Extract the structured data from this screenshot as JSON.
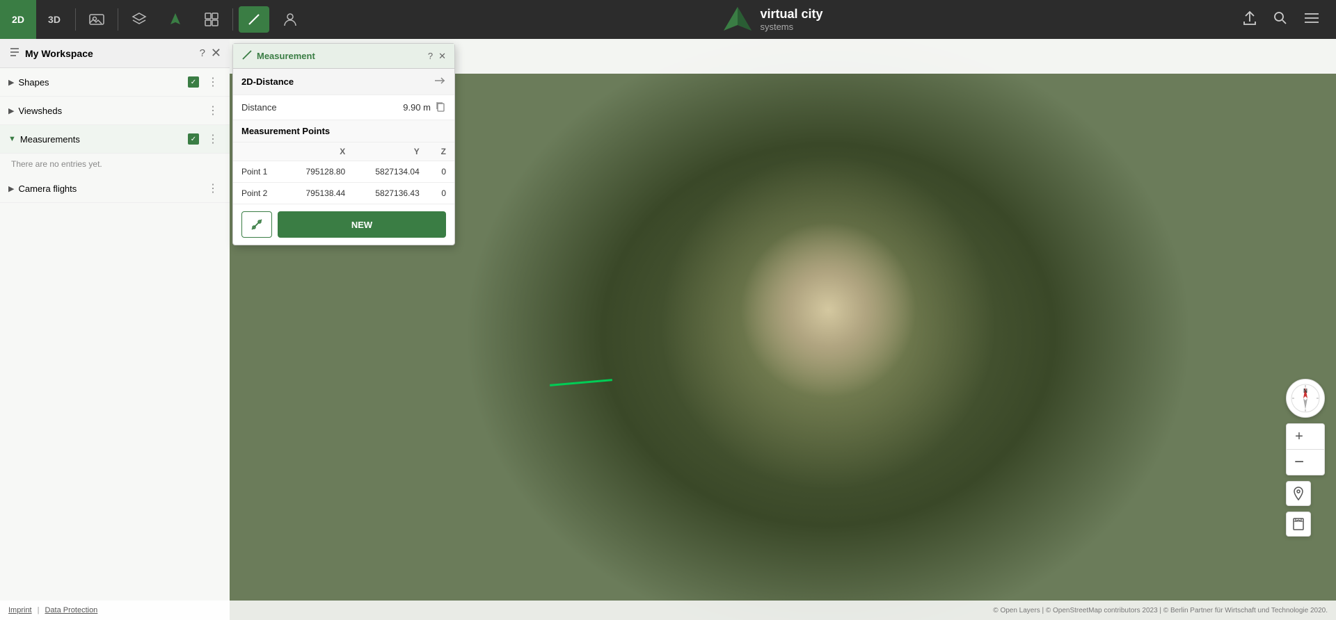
{
  "app": {
    "title": "virtual city systems",
    "title_line1": "virtual city",
    "title_line2": "systems"
  },
  "toolbar": {
    "btn_2d": "2D",
    "btn_3d": "3D",
    "share_icon": "⬆",
    "search_icon": "🔍",
    "menu_icon": "☰"
  },
  "sidebar": {
    "title": "My Workspace",
    "items": [
      {
        "label": "Shapes",
        "checked": true,
        "expanded": false
      },
      {
        "label": "Viewsheds",
        "checked": false,
        "expanded": false
      },
      {
        "label": "Measurements",
        "checked": true,
        "expanded": true
      },
      {
        "label": "Camera flights",
        "checked": false,
        "expanded": false
      }
    ],
    "empty_text": "There are no entries yet."
  },
  "measurement_panel": {
    "title": "Measurement",
    "type_label": "2D-Distance",
    "distance_label": "Distance",
    "distance_value": "9.90 m",
    "points_header": "Measurement Points",
    "col_x": "X",
    "col_y": "Y",
    "col_z": "Z",
    "points": [
      {
        "name": "Point 1",
        "x": "795128.80",
        "y": "5827134.04",
        "z": "0"
      },
      {
        "name": "Point 2",
        "x": "795138.44",
        "y": "5827136.43",
        "z": "0"
      }
    ],
    "new_btn": "NEW"
  },
  "bottom_bar": {
    "imprint": "Imprint",
    "data_protection": "Data Protection",
    "copyright": "© Open Layers  |  © OpenStreetMap contributors 2023  |  © Berlin Partner für Wirtschaft und Technologie 2020."
  },
  "compass": {
    "label": "N"
  }
}
